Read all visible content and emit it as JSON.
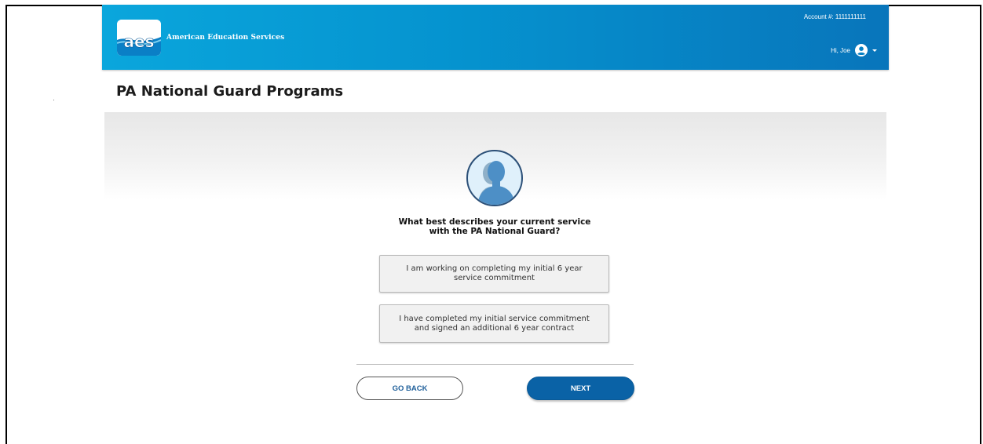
{
  "header": {
    "org_name": "American Education Services",
    "logo_text": "aes",
    "account_label": "Account #: 1111111111",
    "greeting": "Hi, Joe",
    "user_icon": "user-circle-icon",
    "caret_icon": "caret-down-icon"
  },
  "page": {
    "title": "PA National Guard Programs",
    "avatar_icon": "person-silhouette-icon"
  },
  "question": {
    "line1": "What best describes your current service",
    "line2": "with the PA National Guard?"
  },
  "options": [
    {
      "line1": "I am working on completing my initial 6 year",
      "line2": "service commitment"
    },
    {
      "line1": "I have completed my initial service commitment",
      "line2": "and signed an additional 6 year contract"
    }
  ],
  "actions": {
    "back_label": "GO BACK",
    "next_label": "NEXT"
  },
  "colors": {
    "header_start": "#0aa6dc",
    "header_end": "#0875bb",
    "primary_button": "#0a62a6",
    "back_text": "#1f5f9a"
  }
}
